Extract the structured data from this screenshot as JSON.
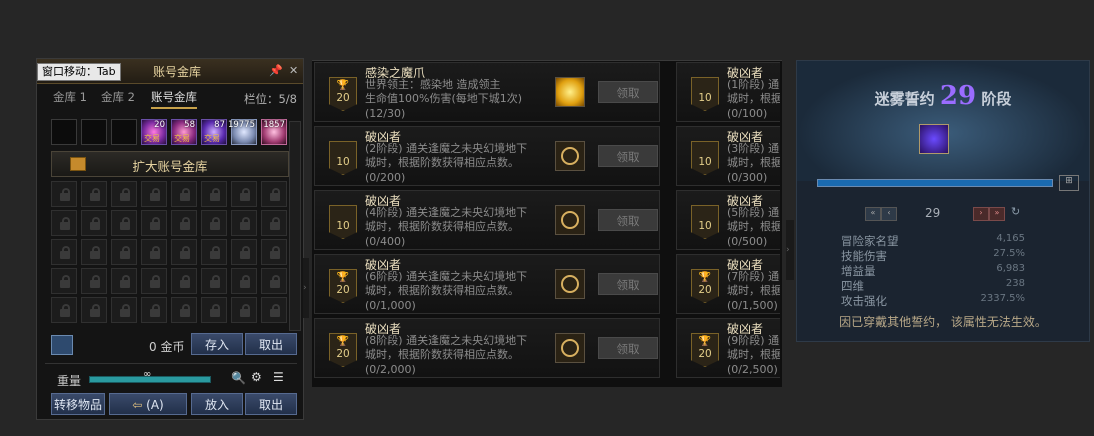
{
  "storage": {
    "tooltip": "窗口移动：Tab",
    "title": "账号金库",
    "tabs": [
      "金库 1",
      "金库 2",
      "账号金库"
    ],
    "slots_label": "栏位：5/8",
    "items": [
      {
        "count": "20",
        "trade": "交易"
      },
      {
        "count": "58",
        "trade": "交易"
      },
      {
        "count": "87",
        "trade": "交易"
      },
      {
        "count": "19775",
        "trade": ""
      },
      {
        "count": "1857",
        "trade": ""
      }
    ],
    "expand_label": "扩大账号金库",
    "gold_label": "0 金币",
    "deposit_label": "存入",
    "withdraw_label": "取出",
    "weight_label": "重量",
    "weight_value": "∞",
    "transfer_label": "转移物品",
    "auto_label": "(A)",
    "put_label": "放入",
    "take_label": "取出"
  },
  "quests": {
    "claim_label": "领取",
    "left": [
      {
        "badge": "20",
        "cup": true,
        "title": "感染之魔爪",
        "desc1": "世界领主：感染地    造成领主",
        "desc2": "生命值100%伤害(每地下城1次)",
        "progress": "(12/30)",
        "reward": "gold"
      },
      {
        "badge": "10",
        "cup": false,
        "title": "破凶者",
        "desc1": "(2阶段) 通关逢魔之未央幻境地下",
        "desc2": "城时，根据阶数获得相应点数。",
        "progress": "(0/200)",
        "reward": "emblem"
      },
      {
        "badge": "10",
        "cup": false,
        "title": "破凶者",
        "desc1": "(4阶段) 通关逢魔之未央幻境地下",
        "desc2": "城时，根据阶数获得相应点数。",
        "progress": "(0/400)",
        "reward": "emblem"
      },
      {
        "badge": "20",
        "cup": true,
        "title": "破凶者",
        "desc1": "(6阶段) 通关逢魔之未央幻境地下",
        "desc2": "城时，根据阶数获得相应点数。",
        "progress": "(0/1,000)",
        "reward": "emblem"
      },
      {
        "badge": "20",
        "cup": true,
        "title": "破凶者",
        "desc1": "(8阶段) 通关逢魔之未央幻境地下",
        "desc2": "城时，根据阶数获得相应点数。",
        "progress": "(0/2,000)",
        "reward": "emblem"
      }
    ],
    "right": [
      {
        "badge": "10",
        "cup": false,
        "title": "破凶者",
        "desc1": "(1阶段) 通",
        "desc2": "城时，根据",
        "progress": "(0/100)"
      },
      {
        "badge": "10",
        "cup": false,
        "title": "破凶者",
        "desc1": "(3阶段) 通",
        "desc2": "城时，根据",
        "progress": "(0/300)"
      },
      {
        "badge": "10",
        "cup": false,
        "title": "破凶者",
        "desc1": "(5阶段) 通",
        "desc2": "城时，根据",
        "progress": "(0/500)"
      },
      {
        "badge": "20",
        "cup": true,
        "title": "破凶者",
        "desc1": "(7阶段) 通",
        "desc2": "城时，根据",
        "progress": "(0/1,500)"
      },
      {
        "badge": "20",
        "cup": true,
        "title": "破凶者",
        "desc1": "(9阶段) 通",
        "desc2": "城时，根据",
        "progress": "(0/2,500)"
      }
    ]
  },
  "mist": {
    "title_prefix": "迷雾誓约",
    "stage": "29",
    "title_suffix": "阶段",
    "page_value": "29",
    "stats": [
      {
        "label": "冒险家名望",
        "value": "4,165"
      },
      {
        "label": "技能伤害",
        "value": "27.5%"
      },
      {
        "label": "增益量",
        "value": "6,983"
      },
      {
        "label": "四维",
        "value": "238"
      },
      {
        "label": "攻击强化",
        "value": "2337.5%"
      }
    ],
    "notice": "因已穿戴其他誓约， 该属性无法生效。"
  },
  "colors": {
    "accent_gold": "#e6d3a0",
    "mist_number": "#9a6cff"
  }
}
